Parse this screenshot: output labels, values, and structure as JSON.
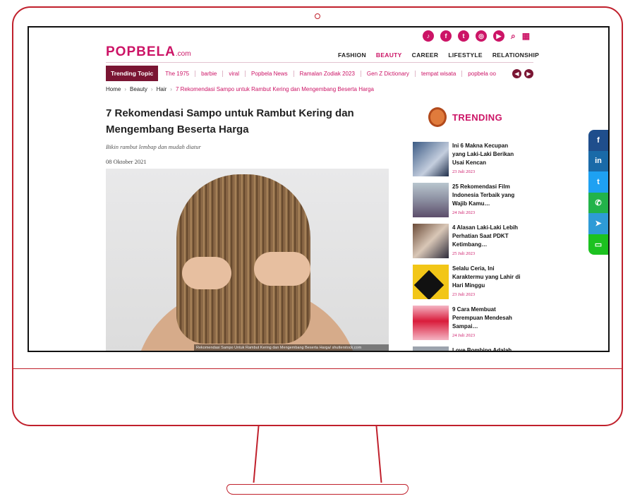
{
  "site": {
    "logo": "POPBELA",
    "logo_suffix": ".com"
  },
  "top_icons": [
    "tiktok-icon",
    "facebook-icon",
    "twitter-icon",
    "instagram-icon",
    "youtube-icon",
    "search-icon",
    "grid-menu-icon"
  ],
  "nav": {
    "items": [
      "FASHION",
      "BEAUTY",
      "CAREER",
      "LIFESTYLE",
      "RELATIONSHIP"
    ],
    "active": "BEAUTY"
  },
  "trending_bar": {
    "label": "Trending Topic",
    "items": [
      "The 1975",
      "barbie",
      "viral",
      "Popbela News",
      "Ramalan Zodiak 2023",
      "Gen Z Dictionary",
      "tempat wisata",
      "popbela oo"
    ]
  },
  "breadcrumb": [
    "Home",
    "Beauty",
    "Hair",
    "7 Rekomendasi Sampo untuk Rambut Kering dan Mengembang Beserta Harga"
  ],
  "article": {
    "title": "7 Rekomendasi Sampo untuk Rambut Kering dan Mengembang Beserta Harga",
    "subtitle": "Bikin rambut lembap dan mudah diatur",
    "date": "08 Oktober 2021",
    "image_caption": "Rekomendasi Sampo Untuk Rambut Kering dan Mengembang Beserta Harga/ shutterstock.com"
  },
  "trending": {
    "heading": "TRENDING",
    "items": [
      {
        "title": "Ini 6 Makna Kecupan yang Laki-Laki Berikan Usai Kencan",
        "date": "23 Juli 2023"
      },
      {
        "title": "25 Rekomendasi Film Indonesia Terbaik yang Wajib Kamu…",
        "date": "24 Juli 2023"
      },
      {
        "title": "4 Alasan Laki-Laki Lebih Perhatian Saat PDKT Ketimbang…",
        "date": "25 Juli 2023"
      },
      {
        "title": "Selalu Ceria, Ini Karaktermu yang Lahir di Hari Minggu",
        "date": "23 Juli 2023"
      },
      {
        "title": "9 Cara Membuat Perempuan Mendesah Sampai…",
        "date": "24 Juli 2023"
      },
      {
        "title": "Love Bombing Adalah",
        "date": ""
      }
    ]
  },
  "share_bar": [
    "facebook-icon",
    "linkedin-icon",
    "twitter-icon",
    "whatsapp-icon",
    "telegram-icon",
    "line-icon"
  ]
}
